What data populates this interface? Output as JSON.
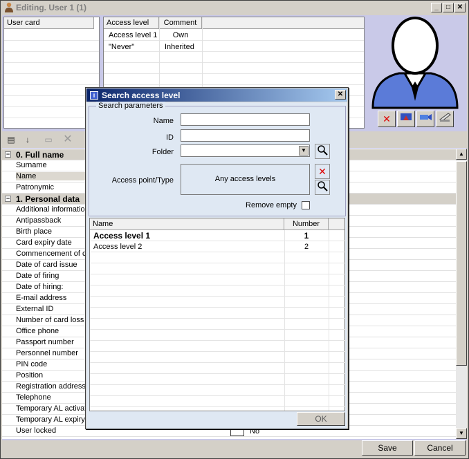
{
  "window": {
    "title": "Editing. User 1 (1)",
    "min": "_",
    "max": "□",
    "close": "✕"
  },
  "user_card": {
    "header": "User card"
  },
  "access_table": {
    "headers": [
      "Access level",
      "Comment"
    ],
    "rows": [
      [
        "Access level 1",
        "Own"
      ],
      [
        "\"Never\"",
        "Inherited"
      ]
    ]
  },
  "properties": {
    "groups": [
      {
        "label": "0. Full name",
        "items": [
          "Surname",
          "Name",
          "Patronymic"
        ]
      },
      {
        "label": "1. Personal data",
        "items": [
          "Additional information",
          "Antipassback",
          "Birth place",
          "Card expiry date",
          "Commencement of card",
          "Date of card issue",
          "Date of firing",
          "Date of hiring:",
          "E-mail address",
          "External ID",
          "Number of card loss",
          "Office phone",
          "Passport number",
          "Personnel number",
          "PIN code",
          "Position",
          "Registration address",
          "Telephone",
          "Temporary AL activation",
          "Temporary AL expiry",
          "User locked"
        ]
      }
    ],
    "user_locked_value": "No",
    "expander": "−"
  },
  "footer": {
    "save": "Save",
    "cancel": "Cancel"
  },
  "dialog": {
    "title": "Search access level",
    "close": "✕",
    "section": "Search parameters",
    "name_label": "Name",
    "id_label": "ID",
    "folder_label": "Folder",
    "access_point_label": "Access point/Type",
    "access_point_value": "Any access levels",
    "remove_empty_label": "Remove empty",
    "columns": [
      "Name",
      "Number"
    ],
    "rows": [
      {
        "name": "Access level 1",
        "number": "1"
      },
      {
        "name": "Access level 2",
        "number": "2"
      }
    ],
    "ok": "OK"
  }
}
